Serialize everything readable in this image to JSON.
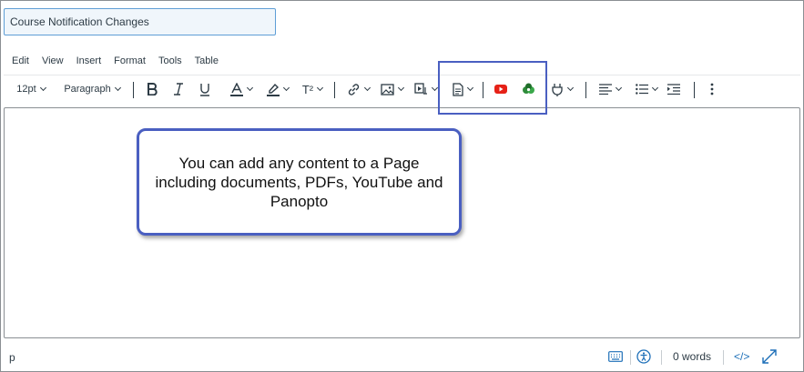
{
  "page_title": {
    "value": "Course Notification Changes"
  },
  "menubar": {
    "items": [
      "Edit",
      "View",
      "Insert",
      "Format",
      "Tools",
      "Table"
    ]
  },
  "toolbar": {
    "font_size": "12pt",
    "block_format": "Paragraph",
    "superscript_label": "T²",
    "icons": [
      "bold-icon",
      "italic-icon",
      "underline-icon",
      "text-color-icon",
      "highlight-icon",
      "superscript-icon",
      "link-icon",
      "image-icon",
      "media-icon",
      "document-icon",
      "youtube-icon",
      "panopto-icon",
      "plugin-icon",
      "align-icon",
      "list-icon",
      "indent-icon",
      "more-icon"
    ]
  },
  "colors": {
    "youtube": "#e62117",
    "panopto": "#2e8b3a",
    "annotation": "#4a5fc1",
    "text_color_bar": "#2d3b45"
  },
  "callout": {
    "text": "You can add any content to a Page including documents, PDFs, YouTube and Panopto"
  },
  "statusbar": {
    "path": "p",
    "word_count": "0 words",
    "html_toggle": "</>"
  }
}
